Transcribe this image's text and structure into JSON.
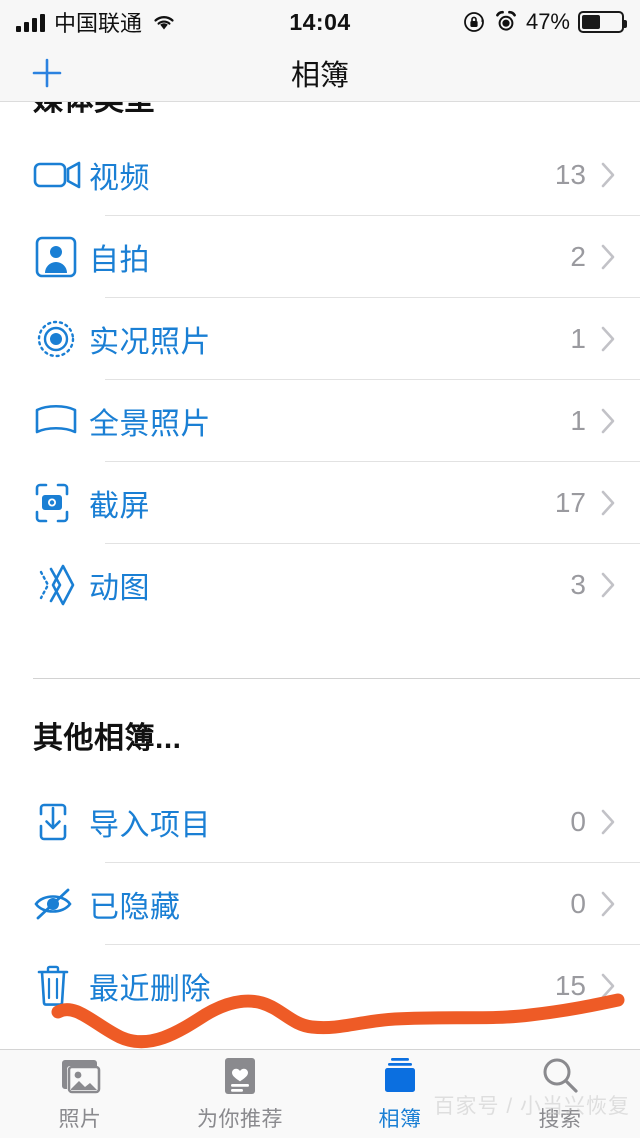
{
  "status_bar": {
    "carrier": "中国联通",
    "time": "14:04",
    "battery_percent": "47%",
    "battery_level": 47,
    "icons": [
      "signal-bars-icon",
      "wifi-icon",
      "rotation-lock-icon",
      "alarm-clock-icon",
      "battery-icon"
    ]
  },
  "nav_bar": {
    "title": "相簿",
    "add_button": "+"
  },
  "sections": [
    {
      "header": "媒体类型",
      "clipped": true,
      "rows": [
        {
          "icon": "video-camera-icon",
          "label": "视频",
          "count": "13"
        },
        {
          "icon": "portrait-person-icon",
          "label": "自拍",
          "count": "2"
        },
        {
          "icon": "live-photo-icon",
          "label": "实况照片",
          "count": "1"
        },
        {
          "icon": "panorama-icon",
          "label": "全景照片",
          "count": "1"
        },
        {
          "icon": "screenshot-camera-icon",
          "label": "截屏",
          "count": "17"
        },
        {
          "icon": "animated-gif-icon",
          "label": "动图",
          "count": "3"
        }
      ]
    },
    {
      "header": "其他相簿...",
      "clipped": false,
      "rows": [
        {
          "icon": "import-tray-icon",
          "label": "导入项目",
          "count": "0"
        },
        {
          "icon": "eye-slash-icon",
          "label": "已隐藏",
          "count": "0"
        },
        {
          "icon": "trash-bin-icon",
          "label": "最近删除",
          "count": "15"
        }
      ]
    }
  ],
  "tab_bar": {
    "tabs": [
      {
        "icon": "photos-stack-icon",
        "label": "照片",
        "active": false
      },
      {
        "icon": "for-you-card-icon",
        "label": "为你推荐",
        "active": false
      },
      {
        "icon": "albums-book-icon",
        "label": "相簿",
        "active": true
      },
      {
        "icon": "magnifier-icon",
        "label": "搜索",
        "active": false
      }
    ]
  },
  "annotation": {
    "type": "handdrawn-underline",
    "color": "#ee5b26"
  },
  "watermark": {
    "text": "百家号 / 小当兴恢复"
  },
  "colors": {
    "accent_blue": "#1a7fd4",
    "count_grey": "#9a9a9f",
    "chevron_grey": "#c7c7cc",
    "bar_background": "#f7f7f7",
    "annotation_orange": "#ee5b26"
  }
}
